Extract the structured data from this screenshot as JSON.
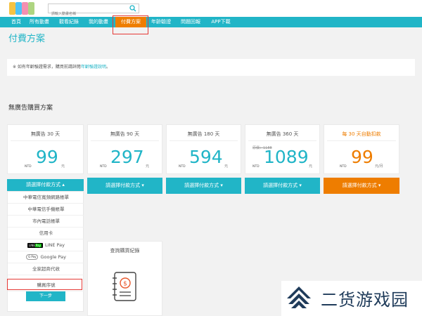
{
  "header": {
    "search": {
      "placeholder": "請輸入動畫名稱"
    },
    "nav": [
      {
        "label": "首頁"
      },
      {
        "label": "所有動畫"
      },
      {
        "label": "觀看紀錄"
      },
      {
        "label": "我的動畫"
      },
      {
        "label": "付費方案",
        "active": true
      },
      {
        "label": "年齡驗證"
      },
      {
        "label": "問題回報"
      },
      {
        "label": "APP下載"
      }
    ]
  },
  "page": {
    "title": "付費方案",
    "notice_prefix": "※ 如有年齡驗證需求，購買前請詳閱",
    "notice_link": "年齡驗證說明",
    "notice_suffix": "。",
    "section_title": "無廣告購買方案"
  },
  "plans": [
    {
      "title": "無廣告 30 天",
      "currency": "NTD",
      "price": "99",
      "unit": "元",
      "button": "請選擇付款方式 ▴",
      "expanded": true
    },
    {
      "title": "無廣告 90 天",
      "currency": "NTD",
      "price": "297",
      "unit": "元",
      "button": "請選擇付款方式 ▾"
    },
    {
      "title": "無廣告 180 天",
      "currency": "NTD",
      "price": "594",
      "unit": "元",
      "button": "請選擇付款方式 ▾"
    },
    {
      "title": "無廣告 360 天",
      "currency": "NTD",
      "original": "原價：1188",
      "price": "1089",
      "unit": "元",
      "button": "請選擇付款方式 ▾"
    },
    {
      "title": "每 30 天自動扣款",
      "currency": "NTD",
      "price": "99",
      "unit": "元/月",
      "button": "請選擇付款方式 ▾",
      "highlight": true
    }
  ],
  "payment_options": [
    {
      "label": "中華電信寬頻網路帳單"
    },
    {
      "label": "中華電信手機帳單"
    },
    {
      "label": "市內電話帳單"
    },
    {
      "label": "信用卡"
    },
    {
      "label": "LINE Pay",
      "badge": "LINE",
      "badge_sub": "Pay"
    },
    {
      "label": "Google Pay",
      "badge": "G Pay"
    },
    {
      "label": "全家超商代收"
    },
    {
      "label": "購買序號",
      "highlighted": true
    }
  ],
  "next_button": "下一步",
  "query": {
    "title": "查詢購買紀錄"
  },
  "watermark": {
    "text": "二货游戏园"
  },
  "colors": {
    "accent": "#21b5c7",
    "orange": "#ee7d00",
    "highlight_red": "#e53935"
  },
  "icons": {
    "search": "search-icon",
    "receipt": "receipt-dollar-icon",
    "logo": "site-logo"
  }
}
